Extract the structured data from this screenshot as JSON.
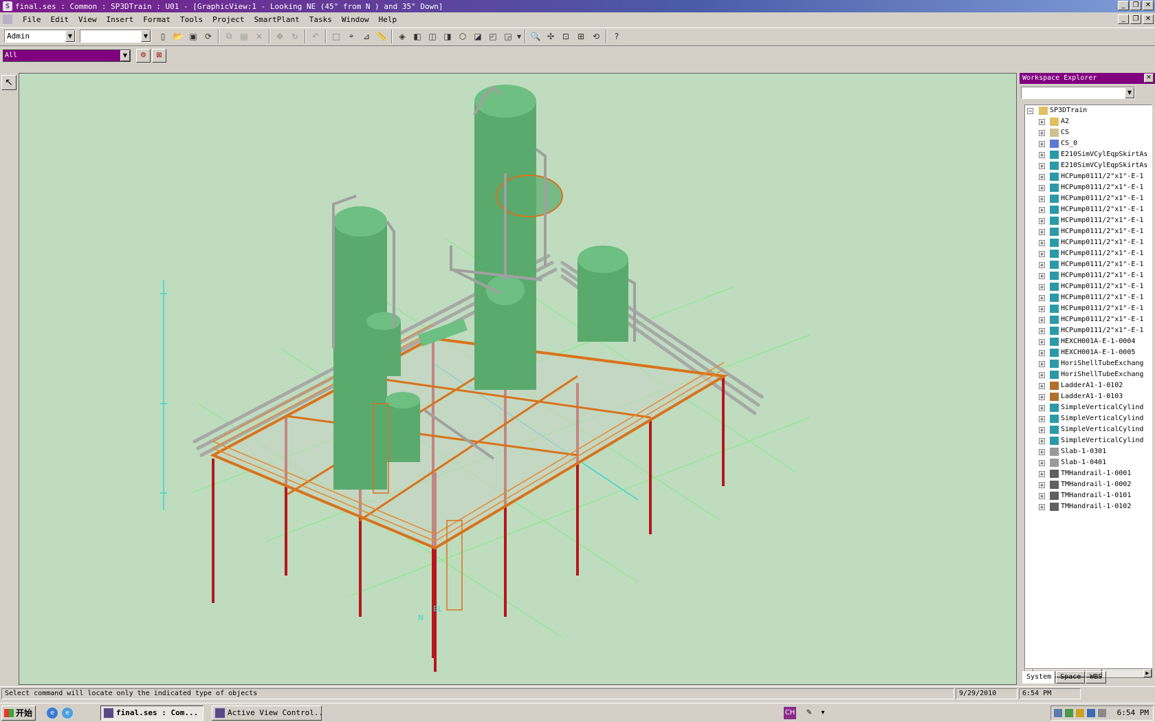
{
  "window": {
    "title": "final.ses : Common : SP3DTrain : U01 - [GraphicView:1 - Looking NE (45° from N ) and 35° Down]"
  },
  "menu": [
    "File",
    "Edit",
    "View",
    "Insert",
    "Format",
    "Tools",
    "Project",
    "SmartPlant",
    "Tasks",
    "Window",
    "Help"
  ],
  "toolbar": {
    "permission_group": "Admin",
    "second_combo": ""
  },
  "filter": {
    "value": "All"
  },
  "explorer": {
    "title": "Workspace Explorer",
    "combo_value": "",
    "root": "SP3DTrain",
    "items": [
      {
        "label": "A2",
        "icon": "folder-icon"
      },
      {
        "label": "CS",
        "icon": "coordinate-system-icon"
      },
      {
        "label": "CS_0",
        "icon": "coordinate-axes-icon"
      },
      {
        "label": "E210SimVCylEqpSkirtAs",
        "icon": "equipment-icon"
      },
      {
        "label": "E210SimVCylEqpSkirtAs",
        "icon": "equipment-icon"
      },
      {
        "label": "HCPump0111/2\"x1\"-E-1",
        "icon": "equipment-icon"
      },
      {
        "label": "HCPump0111/2\"x1\"-E-1",
        "icon": "equipment-icon"
      },
      {
        "label": "HCPump0111/2\"x1\"-E-1",
        "icon": "equipment-icon"
      },
      {
        "label": "HCPump0111/2\"x1\"-E-1",
        "icon": "equipment-icon"
      },
      {
        "label": "HCPump0111/2\"x1\"-E-1",
        "icon": "equipment-icon"
      },
      {
        "label": "HCPump0111/2\"x1\"-E-1",
        "icon": "equipment-icon"
      },
      {
        "label": "HCPump0111/2\"x1\"-E-1",
        "icon": "equipment-icon"
      },
      {
        "label": "HCPump0111/2\"x1\"-E-1",
        "icon": "equipment-icon"
      },
      {
        "label": "HCPump0111/2\"x1\"-E-1",
        "icon": "equipment-icon"
      },
      {
        "label": "HCPump0111/2\"x1\"-E-1",
        "icon": "equipment-icon"
      },
      {
        "label": "HCPump0111/2\"x1\"-E-1",
        "icon": "equipment-icon"
      },
      {
        "label": "HCPump0111/2\"x1\"-E-1",
        "icon": "equipment-icon"
      },
      {
        "label": "HCPump0111/2\"x1\"-E-1",
        "icon": "equipment-icon"
      },
      {
        "label": "HCPump0111/2\"x1\"-E-1",
        "icon": "equipment-icon"
      },
      {
        "label": "HCPump0111/2\"x1\"-E-1",
        "icon": "equipment-icon"
      },
      {
        "label": "HEXCH001A-E-1-0004",
        "icon": "equipment-icon"
      },
      {
        "label": "HEXCH001A-E-1-0005",
        "icon": "equipment-icon"
      },
      {
        "label": "HoriShellTubeExchang",
        "icon": "equipment-icon"
      },
      {
        "label": "HoriShellTubeExchang",
        "icon": "equipment-icon"
      },
      {
        "label": "LadderA1-1-0102",
        "icon": "ladder-icon"
      },
      {
        "label": "LadderA1-1-0103",
        "icon": "ladder-icon"
      },
      {
        "label": "SimpleVerticalCylind",
        "icon": "equipment-icon"
      },
      {
        "label": "SimpleVerticalCylind",
        "icon": "equipment-icon"
      },
      {
        "label": "SimpleVerticalCylind",
        "icon": "equipment-icon"
      },
      {
        "label": "SimpleVerticalCylind",
        "icon": "equipment-icon"
      },
      {
        "label": "Slab-1-0301",
        "icon": "slab-icon"
      },
      {
        "label": "Slab-1-0401",
        "icon": "slab-icon"
      },
      {
        "label": "TMHandrail-1-0001",
        "icon": "handrail-icon"
      },
      {
        "label": "TMHandrail-1-0002",
        "icon": "handrail-icon"
      },
      {
        "label": "TMHandrail-1-0101",
        "icon": "handrail-icon"
      },
      {
        "label": "TMHandrail-1-0102",
        "icon": "handrail-icon"
      }
    ],
    "tabs": [
      "System",
      "Space",
      "WBS"
    ]
  },
  "viewport": {
    "compass_n": "N",
    "compass_el": "EL",
    "colors": {
      "background": "#bfdcbf",
      "vessel": "#5aaa6e",
      "steel": "#b8161c",
      "handrail": "#d9731a",
      "pipe": "#a8a8a8",
      "grid": "#7cf07c",
      "axis": "#3ad4d4"
    }
  },
  "status": {
    "message": "Select command will locate only the indicated type of objects",
    "date": "9/29/2010",
    "time": "6:54 PM"
  },
  "taskbar": {
    "start_label": "开始",
    "tasks": [
      "final.ses : Com...",
      "Active View Control..."
    ],
    "ime": "CH",
    "clock": "6:54 PM"
  }
}
